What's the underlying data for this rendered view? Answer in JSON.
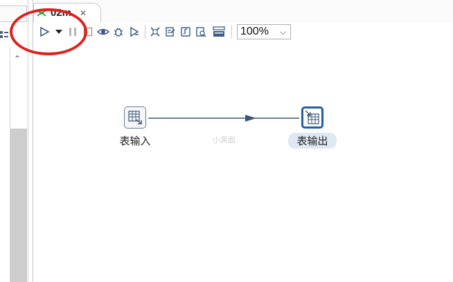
{
  "tab": {
    "title": "02m",
    "close_glyph": "✕",
    "icon": "transformation-icon"
  },
  "toolbar": {
    "run_icon": "play-icon",
    "run_options_icon": "dropdown-arrow-icon",
    "pause_icon": "pause-icon",
    "stop_icon": "stop-icon",
    "preview_icon": "eye-icon",
    "debug_icon": "bug-icon",
    "replay_icon": "replay-icon",
    "verify_icon": "verify-icon",
    "impact_icon": "impact-icon",
    "sql_icon": "sql-icon",
    "explore_db_icon": "explore-db-icon",
    "results_icon": "results-panel-icon",
    "zoom_value": "100%",
    "zoom_chevron": "⌵"
  },
  "left_panel": {
    "tool_icon": "layout-icon",
    "scroll_up_glyph": "⌃"
  },
  "canvas": {
    "steps": [
      {
        "name": "表输入",
        "icon": "table-input-icon",
        "selected": false
      },
      {
        "name": "表输出",
        "icon": "table-output-icon",
        "selected": true
      }
    ],
    "hop": {
      "from": "表输入",
      "to": "表输出"
    },
    "watermark": "小黑面"
  },
  "colors": {
    "annotation": "#e0201b",
    "hop_line": "#3c5676",
    "selected_step_border": "#1f5fa8",
    "selected_label_bg": "#dfe8f3",
    "toolbar_icon": "#3c5a86"
  }
}
